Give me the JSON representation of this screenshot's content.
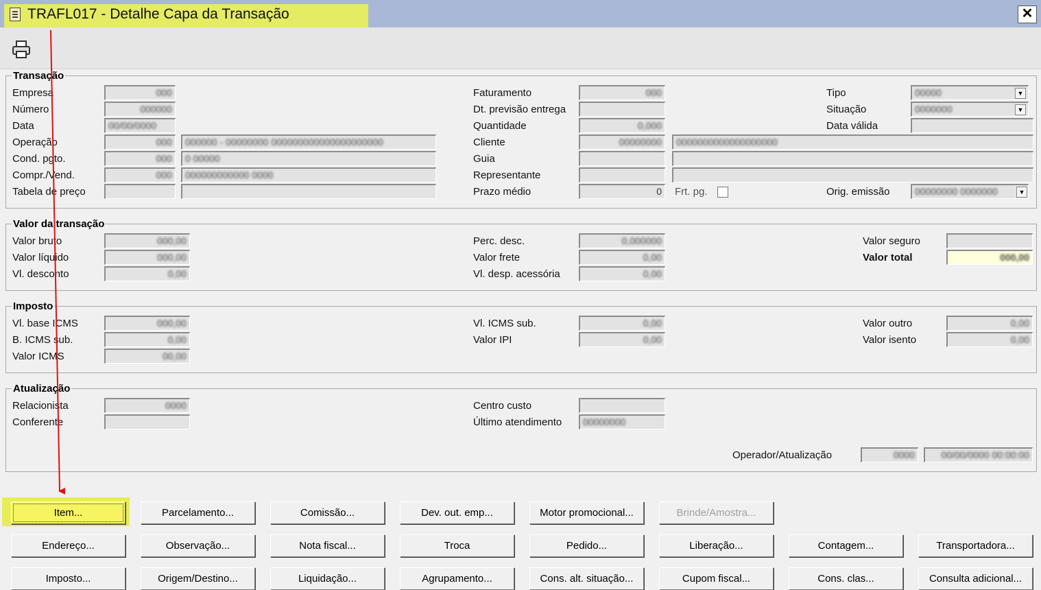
{
  "window": {
    "title": "TRAFL017 - Detalhe Capa da Transação",
    "close_label": "✕"
  },
  "toolbar": {
    "print_icon": "printer-icon"
  },
  "transacao": {
    "legend": "Transação",
    "empresa_label": "Empresa",
    "empresa_value": "000",
    "numero_label": "Número",
    "numero_value": "000000",
    "data_label": "Data",
    "data_value": "00/00/0000",
    "operacao_label": "Operação",
    "operacao_code": "000",
    "operacao_desc": "000000 - 00000000 000000000000000000000",
    "cond_pgto_label": "Cond. pgto.",
    "cond_pgto_code": "000",
    "cond_pgto_desc": "0 00000",
    "compr_vend_label": "Compr./Vend.",
    "compr_vend_code": "000",
    "compr_vend_desc": "000000000000 0000",
    "tabela_preco_label": "Tabela de preço",
    "faturamento_label": "Faturamento",
    "faturamento_value": "000",
    "dt_previsao_label": "Dt. previsão entrega",
    "quantidade_label": "Quantidade",
    "quantidade_value": "0,000",
    "cliente_label": "Cliente",
    "cliente_code": "00000000",
    "cliente_name": "0000000000000000000",
    "guia_label": "Guia",
    "representante_label": "Representante",
    "prazo_medio_label": "Prazo médio",
    "prazo_medio_value": "0",
    "frt_pg_label": "Frt. pg.",
    "tipo_label": "Tipo",
    "tipo_value": "00000",
    "situacao_label": "Situação",
    "situacao_value": "0000000",
    "data_valida_label": "Data válida",
    "orig_emissao_label": "Orig. emissão",
    "orig_emissao_value": "00000000 0000000"
  },
  "valor": {
    "legend": "Valor da transação",
    "valor_bruto_label": "Valor bruto",
    "valor_bruto_value": "000,00",
    "valor_liquido_label": "Valor líquido",
    "valor_liquido_value": "000,00",
    "vl_desconto_label": "Vl. desconto",
    "vl_desconto_value": "0,00",
    "perc_desc_label": "Perc. desc.",
    "perc_desc_value": "0,000000",
    "valor_frete_label": "Valor frete",
    "valor_frete_value": "0,00",
    "vl_desp_label": "Vl. desp. acessória",
    "vl_desp_value": "0,00",
    "valor_seguro_label": "Valor seguro",
    "valor_total_label": "Valor total",
    "valor_total_value": "000,00"
  },
  "imposto": {
    "legend": "Imposto",
    "vl_base_icms_label": "Vl. base ICMS",
    "vl_base_icms_value": "000,00",
    "b_icms_sub_label": "B. ICMS sub.",
    "b_icms_sub_value": "0,00",
    "valor_icms_label": "Valor ICMS",
    "valor_icms_value": "00,00",
    "vl_icms_sub_label": "Vl. ICMS sub.",
    "vl_icms_sub_value": "0,00",
    "valor_ipi_label": "Valor IPI",
    "valor_ipi_value": "0,00",
    "valor_outro_label": "Valor outro",
    "valor_outro_value": "0,00",
    "valor_isento_label": "Valor isento",
    "valor_isento_value": "0,00"
  },
  "atualizacao": {
    "legend": "Atualização",
    "relacionista_label": "Relacionista",
    "relacionista_value": "0000",
    "conferente_label": "Conferente",
    "centro_custo_label": "Centro custo",
    "ultimo_atendimento_label": "Último atendimento",
    "ultimo_atendimento_value": "00000000",
    "operador_label": "Operador/Atualização",
    "operador_code": "0000",
    "operador_datetime": "00/00/0000 00:00:00"
  },
  "buttons": {
    "item": "Item...",
    "parcelamento": "Parcelamento...",
    "comissao": "Comissão...",
    "dev_out_emp": "Dev. out. emp...",
    "motor_promocional": "Motor promocional...",
    "brinde_amostra": "Brinde/Amostra...",
    "endereco": "Endereço...",
    "observacao": "Observação...",
    "nota_fiscal": "Nota fiscal...",
    "troca": "Troca",
    "pedido": "Pedido...",
    "liberacao": "Liberação...",
    "contagem": "Contagem...",
    "transportadora": "Transportadora...",
    "imposto": "Imposto...",
    "origem_destino": "Origem/Destino...",
    "liquidacao": "Liquidação...",
    "agrupamento": "Agrupamento...",
    "cons_alt_situacao": "Cons. alt. situação...",
    "cupom_fiscal": "Cupom fiscal...",
    "cons_clas": "Cons. clas...",
    "consulta_adicional": "Consulta adicional..."
  },
  "colors": {
    "title_bg": "#a9b8d6",
    "highlight": "#e4ec63",
    "arrow": "#e01010",
    "total_bg": "#ffffdc"
  }
}
